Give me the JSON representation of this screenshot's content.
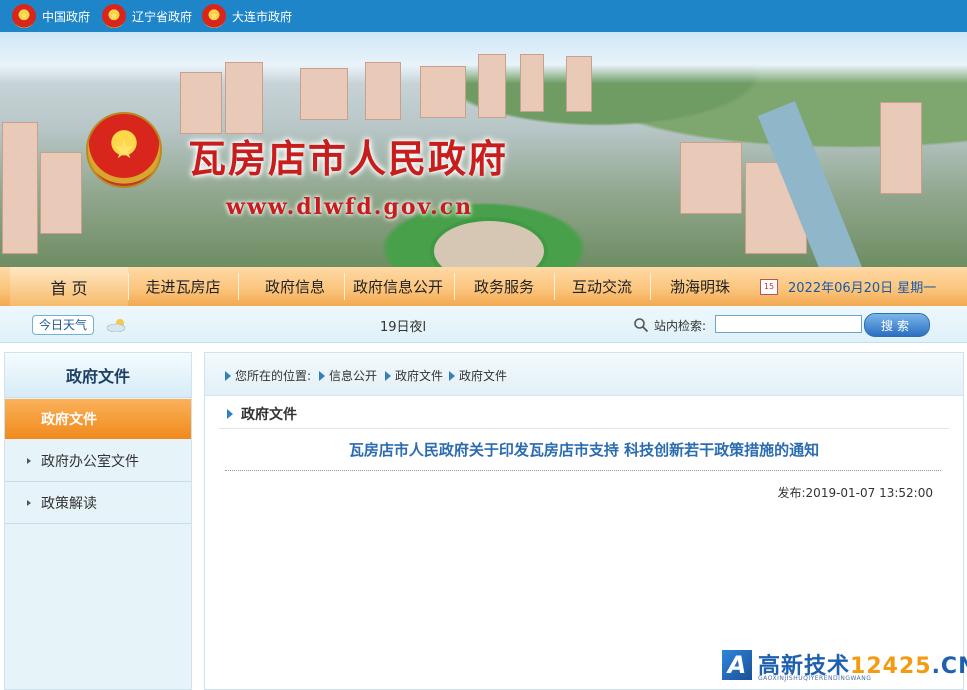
{
  "topbar": {
    "links": [
      {
        "label": "中国政府"
      },
      {
        "label": "辽宁省政府"
      },
      {
        "label": "大连市政府"
      }
    ]
  },
  "banner": {
    "title": "瓦房店市人民政府",
    "url": "www.dlwfd.gov.cn"
  },
  "nav": {
    "items": [
      {
        "label": "首  页"
      },
      {
        "label": "走进瓦房店"
      },
      {
        "label": "政府信息"
      },
      {
        "label": "政府信息公开"
      },
      {
        "label": "政务服务"
      },
      {
        "label": "互动交流"
      },
      {
        "label": "渤海明珠"
      }
    ],
    "date": "2022年06月20日 星期一"
  },
  "subbar": {
    "weather_button": "今日天气",
    "weather_text": "19日夜l",
    "search_label": "站内检索:",
    "search_value": "",
    "search_button": "搜索"
  },
  "sidebar": {
    "heading": "政府文件",
    "active": "政府文件",
    "items": [
      {
        "label": "政府办公室文件"
      },
      {
        "label": "政策解读"
      }
    ]
  },
  "main": {
    "breadcrumb": {
      "prefix": "您所在的位置:",
      "items": [
        "信息公开",
        "政府文件",
        "政府文件"
      ]
    },
    "section_title": "政府文件",
    "doc_title": "瓦房店市人民政府关于印发瓦房店市支持 科技创新若干政策措施的通知",
    "published": "发布:2019-01-07 13:52:00"
  },
  "watermark": {
    "logo_letter": "A",
    "text": "高新技术",
    "number": "12425",
    "domain": ".CN",
    "subtext": "GAOXINJISHUQIYERENDINGWANG"
  },
  "colors": {
    "topbar": "#1e86c8",
    "nav_accent": "#f3a950",
    "active_item": "#f08a1c",
    "title_red": "#c81d1d",
    "doc_title_blue": "#2b6cb0"
  }
}
